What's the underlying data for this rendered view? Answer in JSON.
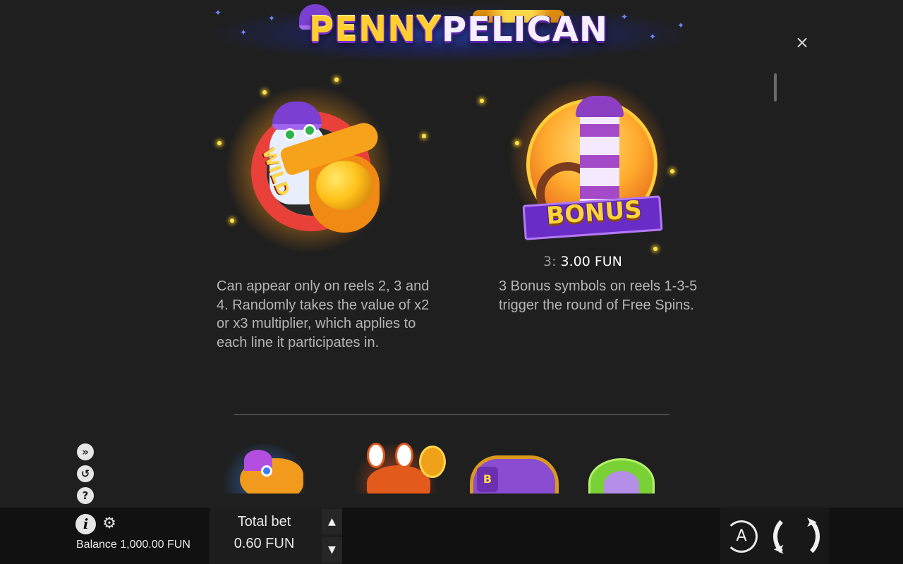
{
  "header": {
    "logo_text_1": "PENNY",
    "logo_text_2": "PELICAN",
    "close_glyph": "×"
  },
  "symbols": [
    {
      "name": "wild",
      "label": "WILD",
      "description": "Can appear only on reels 2, 3 and 4. Randomly takes the value of x2 or x3 multiplier, which applies to each line it participates in."
    },
    {
      "name": "bonus",
      "label": "BONUS",
      "payout_count": "3:",
      "payout_value": "3.00 FUN",
      "description": "3 Bonus symbols on reels 1-3-5 trigger the round of Free Spins."
    }
  ],
  "side_icons": [
    "turbo-icon",
    "autoplay-history-icon",
    "help-icon"
  ],
  "bottom_bar": {
    "balance": "Balance 1,000.00 FUN",
    "total_bet_label": "Total bet",
    "total_bet_value": "0.60 FUN",
    "auto_label": "A",
    "bet_up_glyph": "▲",
    "bet_down_glyph": "▼"
  },
  "colors": {
    "background": "#1f1f1f",
    "bar": "#111111",
    "accent_gold": "#ffcf2e",
    "accent_purple": "#7b3fd1"
  }
}
